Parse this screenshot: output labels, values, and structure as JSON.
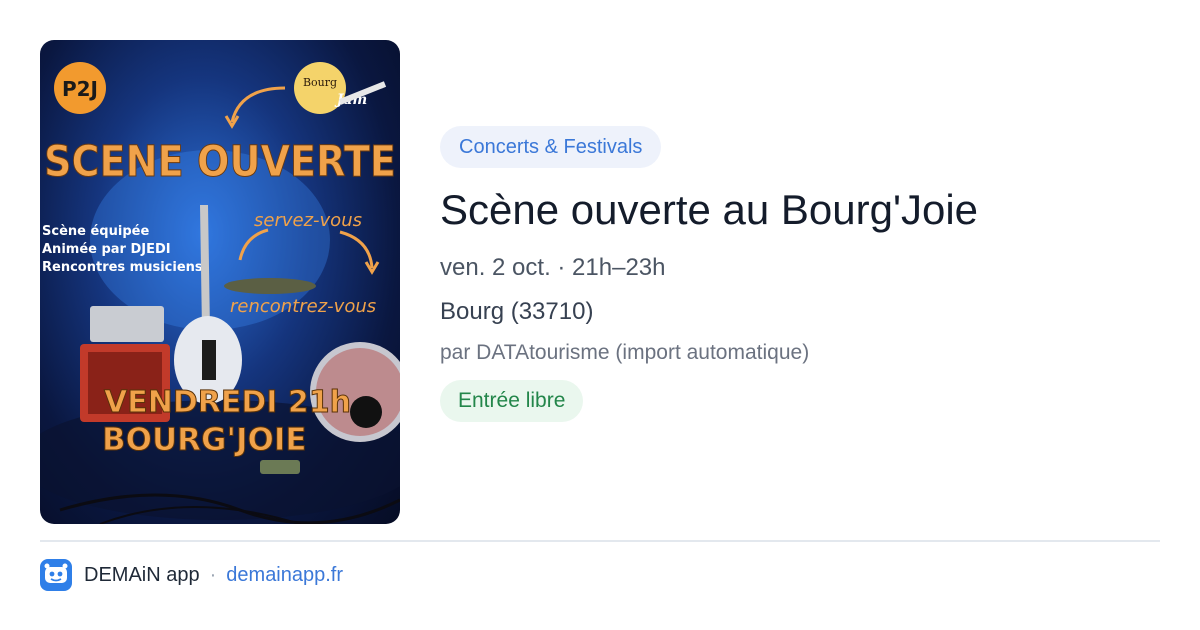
{
  "poster": {
    "logo_left": "P2J",
    "logo_right_line1": "Bourg",
    "logo_right_line2": "Jam",
    "headline": "SCENE OUVERTE",
    "tagline_line1": "Scène équipée",
    "tagline_line2": "Animée par DJEDI",
    "tagline_line3": "Rencontres musiciens",
    "callout_1": "servez-vous",
    "callout_2": "rencontrez-vous",
    "footer_line1": "VENDREDI 21h",
    "footer_line2": "BOURG'JOIE"
  },
  "event": {
    "category": "Concerts & Festivals",
    "title": "Scène ouverte au Bourg'Joie",
    "datetime": "ven. 2 oct. · 21h–23h",
    "location": "Bourg (33710)",
    "source": "par DATAtourisme (import automatique)",
    "price": "Entrée libre"
  },
  "footer": {
    "app_name": "DEMAiN app",
    "separator": "·",
    "link": "demainapp.fr",
    "app_icon": "demain-app-icon"
  },
  "colors": {
    "category_text": "#3b78d8",
    "category_bg": "#eef2fb",
    "price_text": "#23864a",
    "price_bg": "#eaf7ee",
    "poster_orange": "#f0a24a",
    "app_blue": "#2f7fe8"
  }
}
